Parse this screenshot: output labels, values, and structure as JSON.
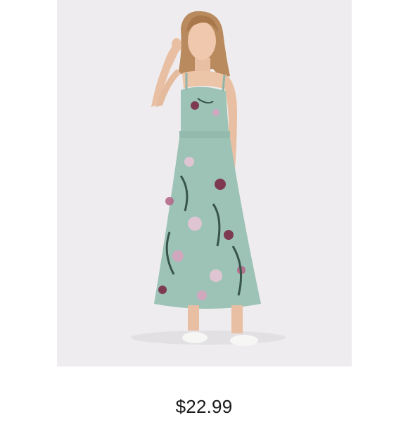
{
  "product": {
    "image_icon": "floral-maxi-dress-photo",
    "price": "$22.99",
    "colors": {
      "image_background": "#eeecee",
      "dress": "#9cc3b6",
      "price_text": "#1a1a1a"
    }
  }
}
